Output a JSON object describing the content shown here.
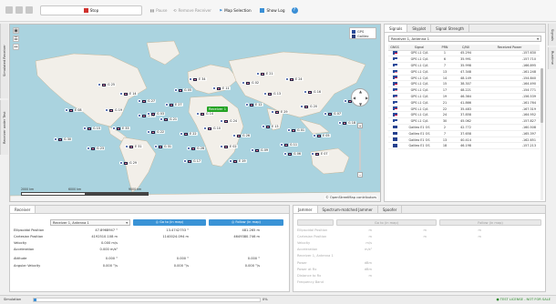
{
  "toolbar": {
    "stop_label": "Stop",
    "pause_label": "Pause",
    "remove_receiver_label": "Remove Receiver",
    "map_selection_label": "Map Selection",
    "show_log_label": "Show Log",
    "colors": {
      "stop": "#d0312d",
      "map": "#3a8fd6",
      "log": "#3a8fd6",
      "help": "#3a8fd6"
    }
  },
  "left_tabs": {
    "simulated_receiver": "Simulated Receiver",
    "receiver_under_test": "Receiver under Test"
  },
  "right_tabs": {
    "signals": "Signals",
    "runtime": "Runtime"
  },
  "map": {
    "legend": [
      "GPS",
      "Galileo"
    ],
    "receiver_label": "Receiver 1",
    "credit": "© OpenStreetMap contributors",
    "scale_labels": [
      "2000 km",
      "6000 km",
      "9000 km"
    ],
    "satellites": [
      {
        "label": "G 25"
      },
      {
        "label": "E 14"
      },
      {
        "label": "G 27"
      },
      {
        "label": "G 05"
      },
      {
        "label": "G 21"
      },
      {
        "label": "E 34"
      },
      {
        "label": "E 11"
      },
      {
        "label": "G 02"
      },
      {
        "label": "G 13"
      },
      {
        "label": "E 24"
      },
      {
        "label": "G 16"
      },
      {
        "label": "E 08"
      },
      {
        "label": "G 19"
      },
      {
        "label": "G 12"
      },
      {
        "label": "E 27"
      },
      {
        "label": "G 14"
      },
      {
        "label": "G 24"
      },
      {
        "label": "E 12"
      },
      {
        "label": "E 29"
      },
      {
        "label": "G 20"
      },
      {
        "label": "G 07"
      },
      {
        "label": "E 15"
      },
      {
        "label": "G 30"
      },
      {
        "label": "G 15"
      },
      {
        "label": "E 33"
      },
      {
        "label": "G 22"
      },
      {
        "label": "E 22"
      },
      {
        "label": "G 10"
      },
      {
        "label": "G 26"
      },
      {
        "label": "E 13"
      },
      {
        "label": "G 01"
      },
      {
        "label": "E 05"
      },
      {
        "label": "G 18"
      },
      {
        "label": "G 23"
      },
      {
        "label": "E 31"
      },
      {
        "label": "G 31"
      },
      {
        "label": "G 28"
      },
      {
        "label": "E 02"
      },
      {
        "label": "G 09"
      },
      {
        "label": "G 11"
      },
      {
        "label": "E 07"
      },
      {
        "label": "G 29"
      },
      {
        "label": "G 17"
      },
      {
        "label": "E 19"
      },
      {
        "label": "G 03"
      },
      {
        "label": "E 21"
      },
      {
        "label": "G 06"
      }
    ]
  },
  "signals_panel": {
    "tabs": [
      "Signals",
      "Skyplot",
      "Signal Strength"
    ],
    "receiver_select": "Receiver 1, Antenna 1",
    "columns": [
      "GNSS",
      "Signal",
      "PRN",
      "C/N0",
      "Received Power"
    ],
    "rows": [
      {
        "gnss": "us",
        "signal": "GPS L1 C/A",
        "prn": "1",
        "cn0": "45.294",
        "power": "-157.630"
      },
      {
        "gnss": "us",
        "signal": "GPS L1 C/A",
        "prn": "6",
        "cn0": "35.991",
        "power": "-157.710"
      },
      {
        "gnss": "us",
        "signal": "GPS L1 C/A",
        "prn": "7",
        "cn0": "35.998",
        "power": "-166.895"
      },
      {
        "gnss": "us",
        "signal": "GPS L1 C/A",
        "prn": "13",
        "cn0": "47.348",
        "power": "-161.248"
      },
      {
        "gnss": "us",
        "signal": "GPS L1 C/A",
        "prn": "14",
        "cn0": "48.149",
        "power": "-154.840"
      },
      {
        "gnss": "us",
        "signal": "GPS L1 C/A",
        "prn": "15",
        "cn0": "38.307",
        "power": "-164.490"
      },
      {
        "gnss": "us",
        "signal": "GPS L1 C/A",
        "prn": "17",
        "cn0": "48.221",
        "power": "-154.771"
      },
      {
        "gnss": "us",
        "signal": "GPS L1 C/A",
        "prn": "19",
        "cn0": "46.364",
        "power": "-156.539"
      },
      {
        "gnss": "us",
        "signal": "GPS L1 C/A",
        "prn": "21",
        "cn0": "41.866",
        "power": "-161.764"
      },
      {
        "gnss": "us",
        "signal": "GPS L1 C/A",
        "prn": "22",
        "cn0": "35.483",
        "power": "-167.319"
      },
      {
        "gnss": "us",
        "signal": "GPS L1 C/A",
        "prn": "24",
        "cn0": "37.858",
        "power": "-164.952"
      },
      {
        "gnss": "us",
        "signal": "GPS L1 C/A",
        "prn": "30",
        "cn0": "45.062",
        "power": "-157.827"
      },
      {
        "gnss": "eu",
        "signal": "Galileo E1 OS",
        "prn": "2",
        "cn0": "42.772",
        "power": "-160.508"
      },
      {
        "gnss": "eu",
        "signal": "Galileo E1 OS",
        "prn": "7",
        "cn0": "37.658",
        "power": "-165.397"
      },
      {
        "gnss": "eu",
        "signal": "Galileo E1 OS",
        "prn": "13",
        "cn0": "40.414",
        "power": "-162.651"
      },
      {
        "gnss": "eu",
        "signal": "Galileo E1 OS",
        "prn": "18",
        "cn0": "46.198",
        "power": "-157.213"
      }
    ]
  },
  "receiver_panel": {
    "tab": "Receiver",
    "select": "Receiver 1, Antenna 1",
    "goto_label": "Go to (in map)",
    "follow_label": "Follow (in map)",
    "rows": [
      {
        "key": "Ellipsoidal Position",
        "v1": "47.8968947 °",
        "v2": "13.4742753 °",
        "v3": "481.265 m"
      },
      {
        "key": "Cartesian Position",
        "v1": "4192510.108 m",
        "v2": "1140024.094 m",
        "v3": "4649380.746 m"
      },
      {
        "key": "Velocity",
        "v1": "0.000 m/s",
        "v2": "",
        "v3": ""
      },
      {
        "key": "Acceleration",
        "v1": "0.000 m/s²",
        "v2": "",
        "v3": ""
      },
      {
        "key": "Attitude",
        "v1": "0.000 °",
        "v2": "0.000 °",
        "v3": "0.000 °"
      },
      {
        "key": "Angular Velocity",
        "v1": "0.000 °/s",
        "v2": "0.000 °/s",
        "v3": "0.000 °/s"
      }
    ]
  },
  "jammer_panel": {
    "tabs": [
      "Jammer",
      "Spectrum-matched Jammer",
      "Spoofer"
    ],
    "goto_label": "Go to (in map)",
    "follow_label": "Follow (in map)",
    "rows": [
      {
        "key": "Ellipsoidal Position",
        "v1": "m",
        "v2": "m",
        "v3": "m"
      },
      {
        "key": "Cartesian Position",
        "v1": "m",
        "v2": "m",
        "v3": "m"
      },
      {
        "key": "Velocity",
        "v1": "m/s",
        "v2": "",
        "v3": ""
      },
      {
        "key": "Acceleration",
        "v1": "m/s²",
        "v2": "",
        "v3": ""
      },
      {
        "key": "Receiver 1, Antenna 1",
        "v1": "",
        "v2": "",
        "v3": ""
      },
      {
        "key": "Power",
        "v1": "dBm",
        "v2": "",
        "v3": ""
      },
      {
        "key": "Power at Rx",
        "v1": "dBm",
        "v2": "",
        "v3": ""
      },
      {
        "key": "Distance to Rx",
        "v1": "m",
        "v2": "",
        "v3": ""
      },
      {
        "key": "Frequency Band",
        "v1": "",
        "v2": "",
        "v3": ""
      }
    ]
  },
  "statusbar": {
    "left_label": "Simulation",
    "progress": 0.012,
    "center_text": "0%",
    "right_text": "TEST LICENSE - NOT FOR SALE"
  }
}
